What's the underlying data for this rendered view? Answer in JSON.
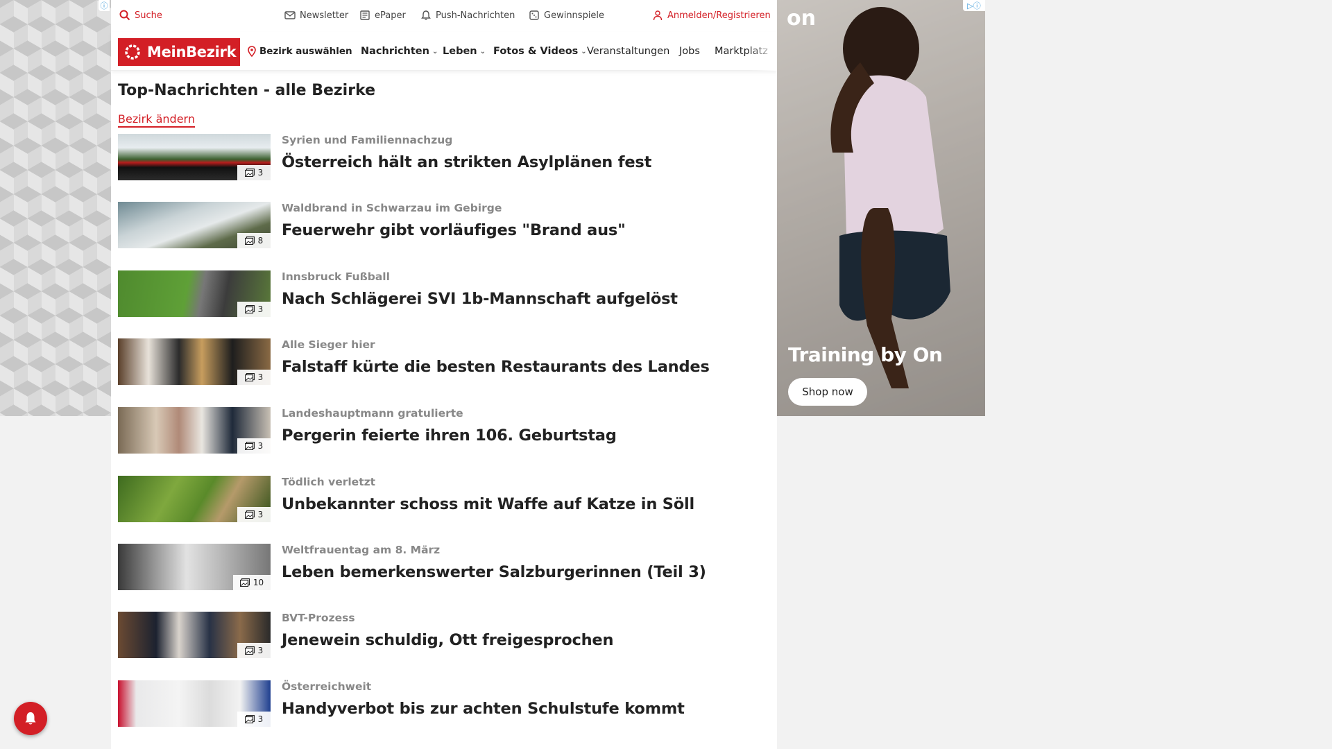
{
  "topbar": {
    "search_label": "Suche",
    "newsletter_label": "Newsletter",
    "epaper_label": "ePaper",
    "push_label": "Push-Nachrichten",
    "gewinnspiele_label": "Gewinnspiele",
    "login_label": "Anmelden/Registrieren"
  },
  "nav": {
    "logo_text": "MeinBezirk",
    "select_district": "Bezirk auswählen",
    "items": [
      "Nachrichten",
      "Leben",
      "Fotos & Videos",
      "Veranstaltungen",
      "Jobs",
      "Marktplatz"
    ]
  },
  "page": {
    "title": "Top-Nachrichten - alle Bezirke",
    "change_district": "Bezirk ändern"
  },
  "articles": [
    {
      "kicker": "Syrien und Familiennachzug",
      "headline": "Österreich hält an strikten Asylplänen fest",
      "photo_count": "3"
    },
    {
      "kicker": "Waldbrand in Schwarzau im Gebirge",
      "headline": "Feuerwehr gibt vorläufiges \"Brand aus\"",
      "photo_count": "8"
    },
    {
      "kicker": "Innsbruck Fußball",
      "headline": "Nach Schlägerei SVI 1b-Mannschaft aufgelöst",
      "photo_count": "3"
    },
    {
      "kicker": "Alle Sieger hier",
      "headline": "Falstaff kürte die besten Restaurants des Landes",
      "photo_count": "3"
    },
    {
      "kicker": "Landeshauptmann gratulierte",
      "headline": "Pergerin feierte ihren 106. Geburtstag",
      "photo_count": "3"
    },
    {
      "kicker": "Tödlich verletzt",
      "headline": "Unbekannter schoss mit Waffe auf Katze in Söll",
      "photo_count": "3"
    },
    {
      "kicker": "Weltfrauentag am 8. März",
      "headline": "Leben bemerkenswerter Salzburgerinnen (Teil 3)",
      "photo_count": "10"
    },
    {
      "kicker": "BVT-Prozess",
      "headline": "Jenewein schuldig, Ott freigesprochen",
      "photo_count": "3"
    },
    {
      "kicker": "Österreichweit",
      "headline": "Handyverbot bis zur achten Schulstufe kommt",
      "photo_count": "3"
    }
  ],
  "ad": {
    "brand": "on",
    "title": "Training by On",
    "cta": "Shop now"
  },
  "colors": {
    "brand_red": "#d31f26"
  }
}
